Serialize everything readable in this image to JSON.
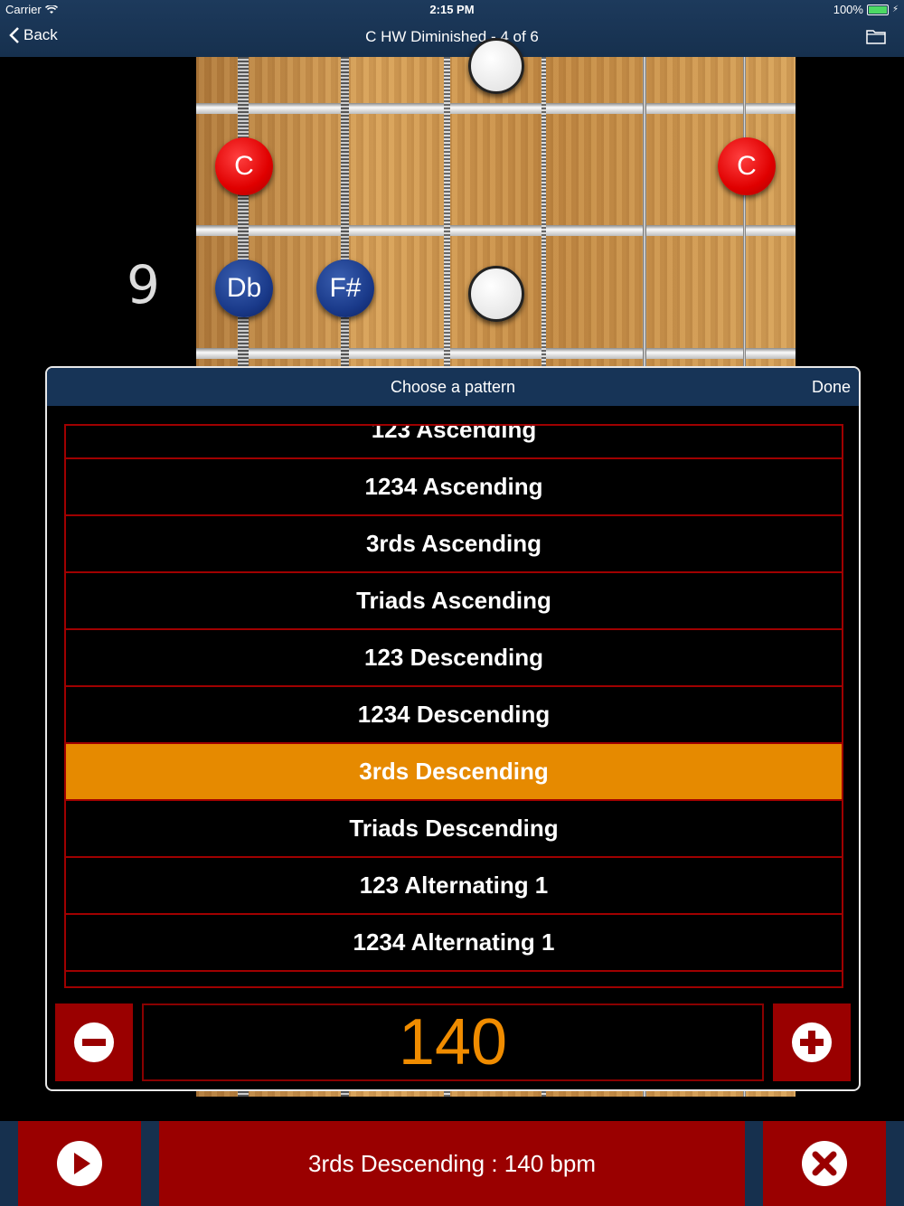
{
  "status_bar": {
    "carrier": "Carrier",
    "time": "2:15 PM",
    "battery": "100%"
  },
  "nav": {
    "back_label": "Back",
    "title": "C HW Diminished - 4 of 6"
  },
  "fretboard": {
    "fret_number": "9",
    "notes": {
      "c_left": "C",
      "c_right": "C",
      "db": "Db",
      "f_sharp": "F#"
    }
  },
  "picker": {
    "title": "Choose a pattern",
    "done_label": "Done",
    "items": [
      "123 Ascending",
      "1234 Ascending",
      "3rds Ascending",
      "Triads Ascending",
      "123 Descending",
      "1234 Descending",
      "3rds Descending",
      "Triads Descending",
      "123 Alternating 1",
      "1234 Alternating 1"
    ],
    "selected": "3rds Descending",
    "bpm": "140"
  },
  "bottom_bar": {
    "now_playing": "3rds Descending : 140 bpm"
  },
  "colors": {
    "accent": "#e68a00",
    "button_red": "#9a0000",
    "nav_blue": "#173457"
  }
}
